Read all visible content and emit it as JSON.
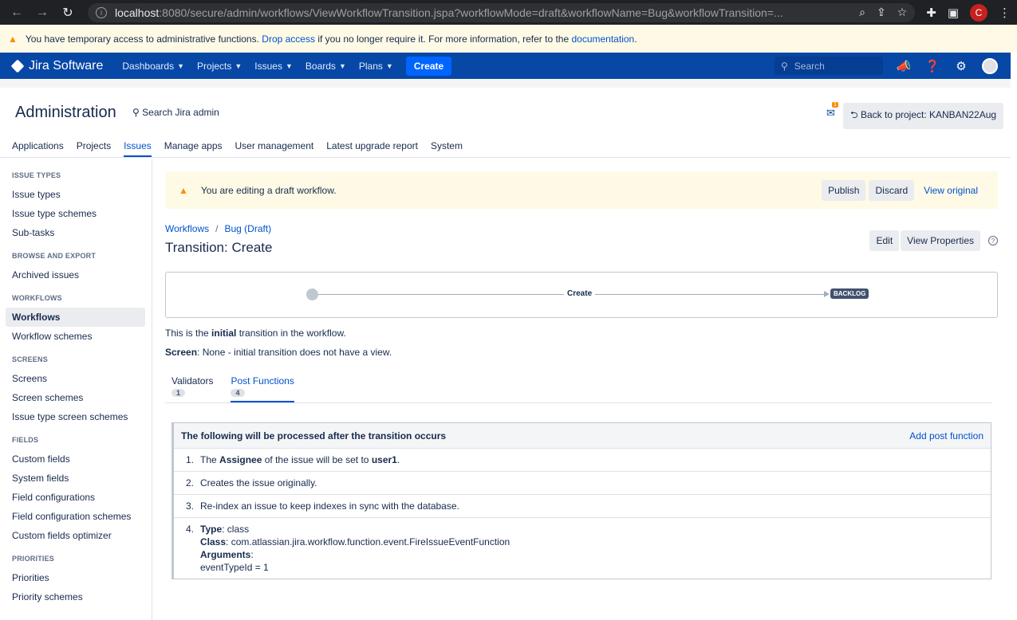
{
  "browser": {
    "url_host": "localhost",
    "url_path": ":8080/secure/admin/workflows/ViewWorkflowTransition.jspa?workflowMode=draft&workflowName=Bug&workflowTransition=...",
    "profile_initial": "C"
  },
  "access_banner": {
    "text_before": "You have temporary access to administrative functions.",
    "drop_link": "Drop access",
    "text_middle": "if you no longer require it. For more information, refer to the",
    "doc_link": "documentation",
    "text_after": "."
  },
  "jira_header": {
    "product": "Jira Software",
    "menu": [
      "Dashboards",
      "Projects",
      "Issues",
      "Boards",
      "Plans"
    ],
    "create_label": "Create",
    "search_placeholder": "Search"
  },
  "admin": {
    "title": "Administration",
    "search_label": "Search Jira admin",
    "notification_count": "1",
    "back_label": "Back to project: KANBAN22Aug",
    "tabs": [
      "Applications",
      "Projects",
      "Issues",
      "Manage apps",
      "User management",
      "Latest upgrade report",
      "System"
    ],
    "active_tab": "Issues"
  },
  "sidebar": {
    "groups": [
      {
        "heading": "ISSUE TYPES",
        "items": [
          "Issue types",
          "Issue type schemes",
          "Sub-tasks"
        ]
      },
      {
        "heading": "BROWSE AND EXPORT",
        "items": [
          "Archived issues"
        ]
      },
      {
        "heading": "WORKFLOWS",
        "items": [
          "Workflows",
          "Workflow schemes"
        ]
      },
      {
        "heading": "SCREENS",
        "items": [
          "Screens",
          "Screen schemes",
          "Issue type screen schemes"
        ]
      },
      {
        "heading": "FIELDS",
        "items": [
          "Custom fields",
          "System fields",
          "Field configurations",
          "Field configuration schemes",
          "Custom fields optimizer"
        ]
      },
      {
        "heading": "PRIORITIES",
        "items": [
          "Priorities",
          "Priority schemes"
        ]
      }
    ],
    "active_item": "Workflows"
  },
  "draft_banner": {
    "message": "You are editing a draft workflow.",
    "publish": "Publish",
    "discard": "Discard",
    "view_original": "View original"
  },
  "breadcrumb": {
    "root": "Workflows",
    "sep": "/",
    "current": "Bug (Draft)"
  },
  "page": {
    "title": "Transition: Create",
    "edit": "Edit",
    "view_properties": "View Properties",
    "help": "?"
  },
  "diagram": {
    "transition": "Create",
    "target_status": "BACKLOG"
  },
  "info": {
    "line1_pre": "This is the",
    "line1_bold": "initial",
    "line1_post": "transition in the workflow.",
    "screen_label": "Screen",
    "screen_value": ": None - initial transition does not have a view."
  },
  "tabs": [
    {
      "label": "Validators",
      "count": "1"
    },
    {
      "label": "Post Functions",
      "count": "4"
    }
  ],
  "post_functions": {
    "heading": "The following will be processed after the transition occurs",
    "add_label": "Add post function",
    "items": [
      {
        "num": "1.",
        "pre": "The",
        "b1": "Assignee",
        "mid": "of the issue will be set to",
        "b2": "user1",
        "post": "."
      },
      {
        "num": "2.",
        "text": "Creates the issue originally."
      },
      {
        "num": "3.",
        "text": "Re-index an issue to keep indexes in sync with the database."
      }
    ],
    "item4": {
      "num": "4.",
      "type_label": "Type",
      "type_value": ": class",
      "class_label": "Class",
      "class_value": ": com.atlassian.jira.workflow.function.event.FireIssueEventFunction",
      "args_label": "Arguments",
      "args_colon": ":",
      "arg_line": "eventTypeId = 1"
    }
  },
  "colors": {
    "header_blue": "#0747a6",
    "link_blue": "#0052cc",
    "warning_bg": "#fffae6",
    "warning_icon": "#ff8b00"
  }
}
